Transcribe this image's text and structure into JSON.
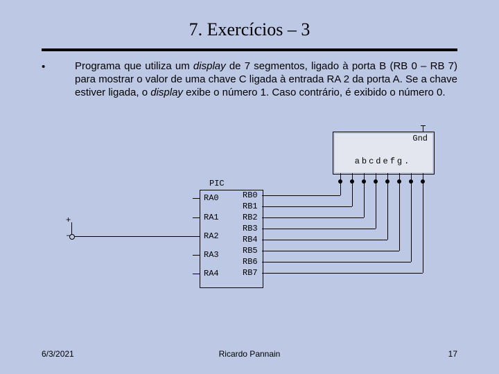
{
  "title": "7. Exercícios – 3",
  "bullet": "•",
  "body_pre": "Programa que utiliza um ",
  "body_i1": "display",
  "body_mid": " de 7 segmentos, ligado à porta B (RB 0 – RB 7) para mostrar o valor de uma chave C ligada à entrada RA 2 da porta A. Se a chave estiver ligada, o ",
  "body_i2": "display",
  "body_post": " exibe o número 1. Caso contrário, é exibido o número 0.",
  "diagram": {
    "pic_label": "PIC",
    "gnd_label": "Gnd",
    "seg_pins": "abcdefg.",
    "left_pins": [
      "RA0",
      "RA1",
      "RA2",
      "RA3",
      "RA4"
    ],
    "right_pins": [
      "RB0",
      "RB1",
      "RB2",
      "RB3",
      "RB4",
      "RB5",
      "RB6",
      "RB7"
    ],
    "sw_plus": "+",
    "sw_minus": "–"
  },
  "footer": {
    "date": "6/3/2021",
    "author": "Ricardo Pannain",
    "page": "17"
  }
}
